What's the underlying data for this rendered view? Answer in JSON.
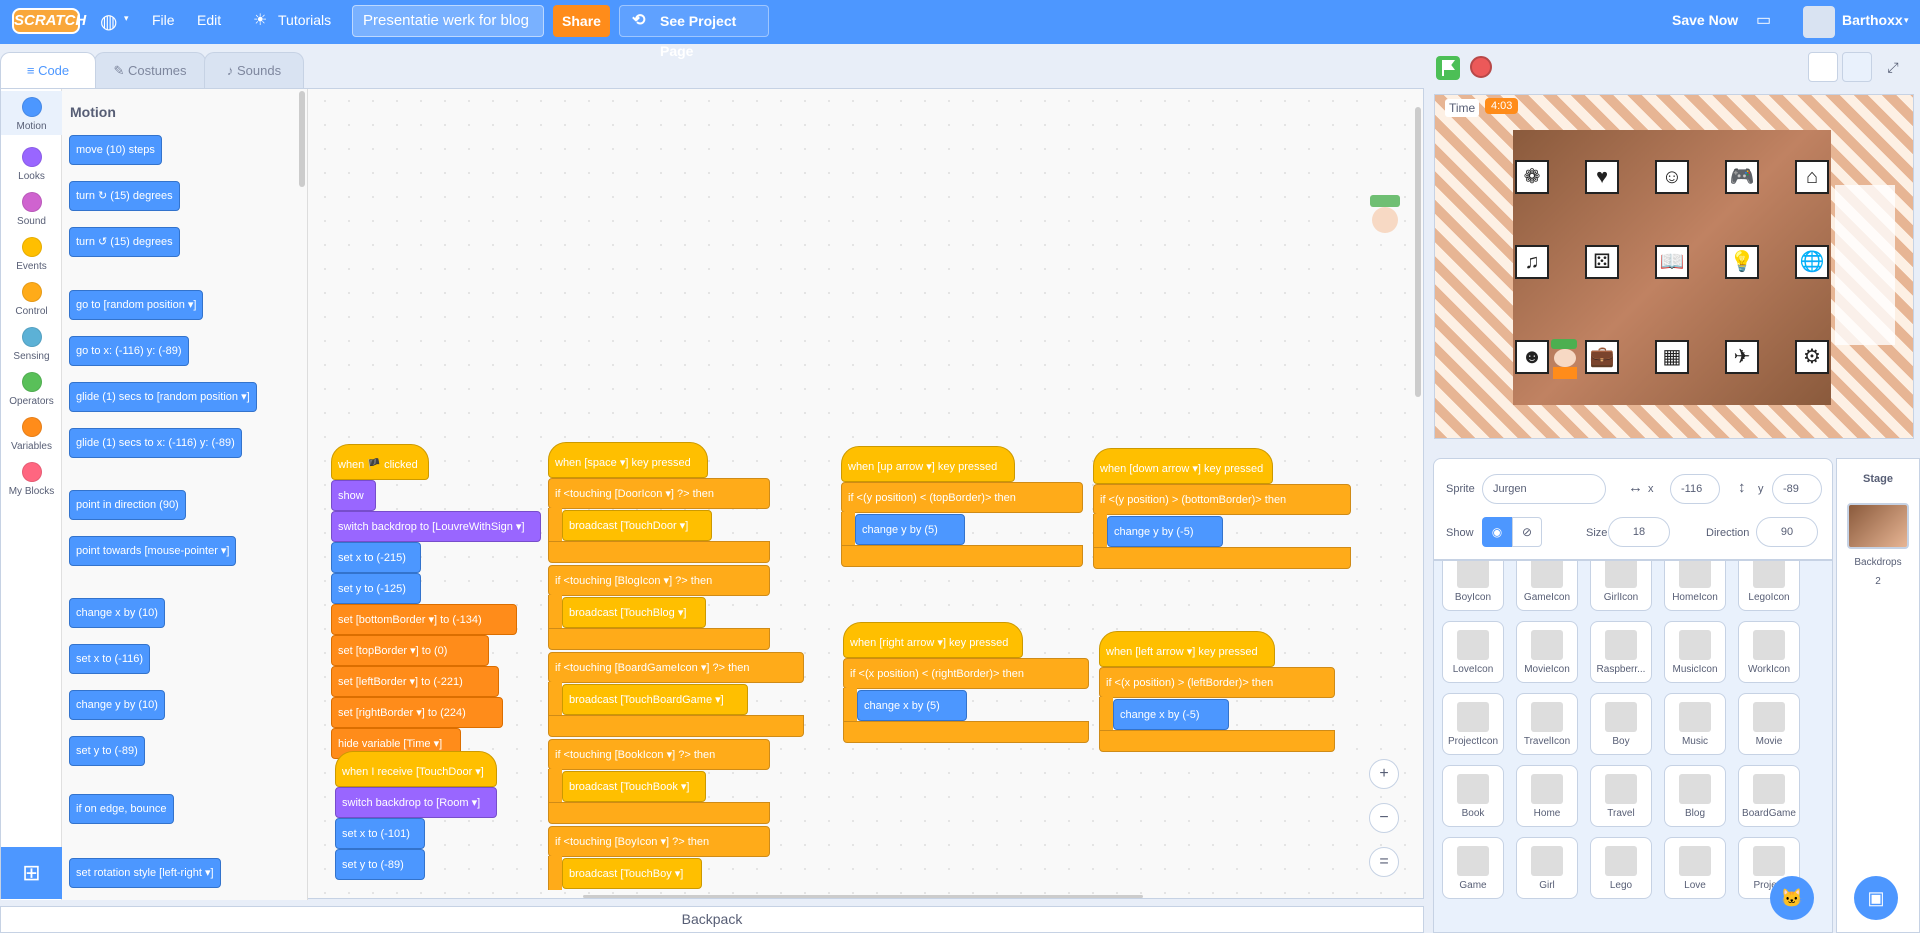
{
  "menubar": {
    "logo": "SCRATCH",
    "file": "File",
    "edit": "Edit",
    "tutorials": "Tutorials",
    "project_title": "Presentatie werk for blog",
    "share": "Share",
    "see_project": "See Project Page",
    "save_now": "Save Now",
    "username": "Barthoxx"
  },
  "tabs": {
    "code": "Code",
    "costumes": "Costumes",
    "sounds": "Sounds"
  },
  "categories": [
    "Motion",
    "Looks",
    "Sound",
    "Events",
    "Control",
    "Sensing",
    "Operators",
    "Variables",
    "My Blocks"
  ],
  "category_colors": [
    "#4c97ff",
    "#9966ff",
    "#cf63cf",
    "#ffbf00",
    "#ffab19",
    "#5cb1d6",
    "#59c059",
    "#ff8c1a",
    "#ff6680"
  ],
  "palette": {
    "title": "Motion",
    "blocks": [
      "move (10) steps",
      "turn ↻ (15) degrees",
      "turn ↺ (15) degrees",
      "go to [random position ▾]",
      "go to x: (-116) y: (-89)",
      "glide (1) secs to [random position ▾]",
      "glide (1) secs to x: (-116) y: (-89)",
      "point in direction (90)",
      "point towards [mouse-pointer ▾]",
      "change x by (10)",
      "set x to (-116)",
      "change y by (10)",
      "set y to (-89)",
      "if on edge, bounce",
      "set rotation style [left-right ▾]"
    ]
  },
  "scripts": {
    "s1": [
      "when 🏴 clicked",
      "show",
      "switch backdrop to [LouvreWithSign ▾]",
      "set x to (-215)",
      "set y to (-125)",
      "set [bottomBorder ▾] to (-134)",
      "set [topBorder ▾] to (0)",
      "set [leftBorder ▾] to (-221)",
      "set [rightBorder ▾] to (224)",
      "hide variable [Time ▾]"
    ],
    "s2": [
      "when I receive [TouchDoor ▾]",
      "switch backdrop to [Room ▾]",
      "set x to (-101)",
      "set y to (-89)"
    ],
    "s3": [
      "when [space ▾] key pressed",
      "if <touching [DoorIcon ▾] ?> then",
      "broadcast [TouchDoor ▾]",
      "if <touching [BlogIcon ▾] ?> then",
      "broadcast [TouchBlog ▾]",
      "if <touching [BoardGameIcon ▾] ?> then",
      "broadcast [TouchBoardGame ▾]",
      "if <touching [BookIcon ▾] ?> then",
      "broadcast [TouchBook ▾]",
      "if <touching [BoyIcon ▾] ?> then",
      "broadcast [TouchBoy ▾]"
    ],
    "s4": [
      "when [up arrow ▾] key pressed",
      "if <(y position) < (topBorder)> then",
      "change y by (5)"
    ],
    "s5": [
      "when [down arrow ▾] key pressed",
      "if <(y position) > (bottomBorder)> then",
      "change y by (-5)"
    ],
    "s6": [
      "when [right arrow ▾] key pressed",
      "if <(x position) < (rightBorder)> then",
      "change x by (5)"
    ],
    "s7": [
      "when [left arrow ▾] key pressed",
      "if <(x position) > (leftBorder)> then",
      "change x by (-5)"
    ]
  },
  "zoom": {
    "in": "+",
    "out": "−",
    "reset": "="
  },
  "backpack": "Backpack",
  "stage": {
    "timer_label": "Time",
    "timer_value": "4:03",
    "tile_icons": [
      "❁",
      "♥",
      "☺",
      "🎮",
      "⌂",
      "♫",
      "⚄",
      "📖",
      "💡",
      "🌐",
      "☻",
      "💼",
      "▦",
      "✈",
      "⚙"
    ]
  },
  "sprite_info": {
    "sprite_label": "Sprite",
    "sprite_name": "Jurgen",
    "x_label": "x",
    "x_value": "-116",
    "y_label": "y",
    "y_value": "-89",
    "show_label": "Show",
    "size_label": "Size",
    "size_value": "18",
    "direction_label": "Direction",
    "direction_value": "90"
  },
  "sprites": [
    "BoyIcon",
    "GameIcon",
    "GirlIcon",
    "HomeIcon",
    "LegoIcon",
    "LoveIcon",
    "MovieIcon",
    "Raspberr...",
    "MusicIcon",
    "WorkIcon",
    "ProjectIcon",
    "TravelIcon",
    "Boy",
    "Music",
    "Movie",
    "Book",
    "Home",
    "Travel",
    "Blog",
    "BoardGame",
    "Game",
    "Girl",
    "Lego",
    "Love",
    "Project"
  ],
  "stage_panel": {
    "title": "Stage",
    "backdrops_label": "Backdrops",
    "backdrops_count": "2"
  }
}
